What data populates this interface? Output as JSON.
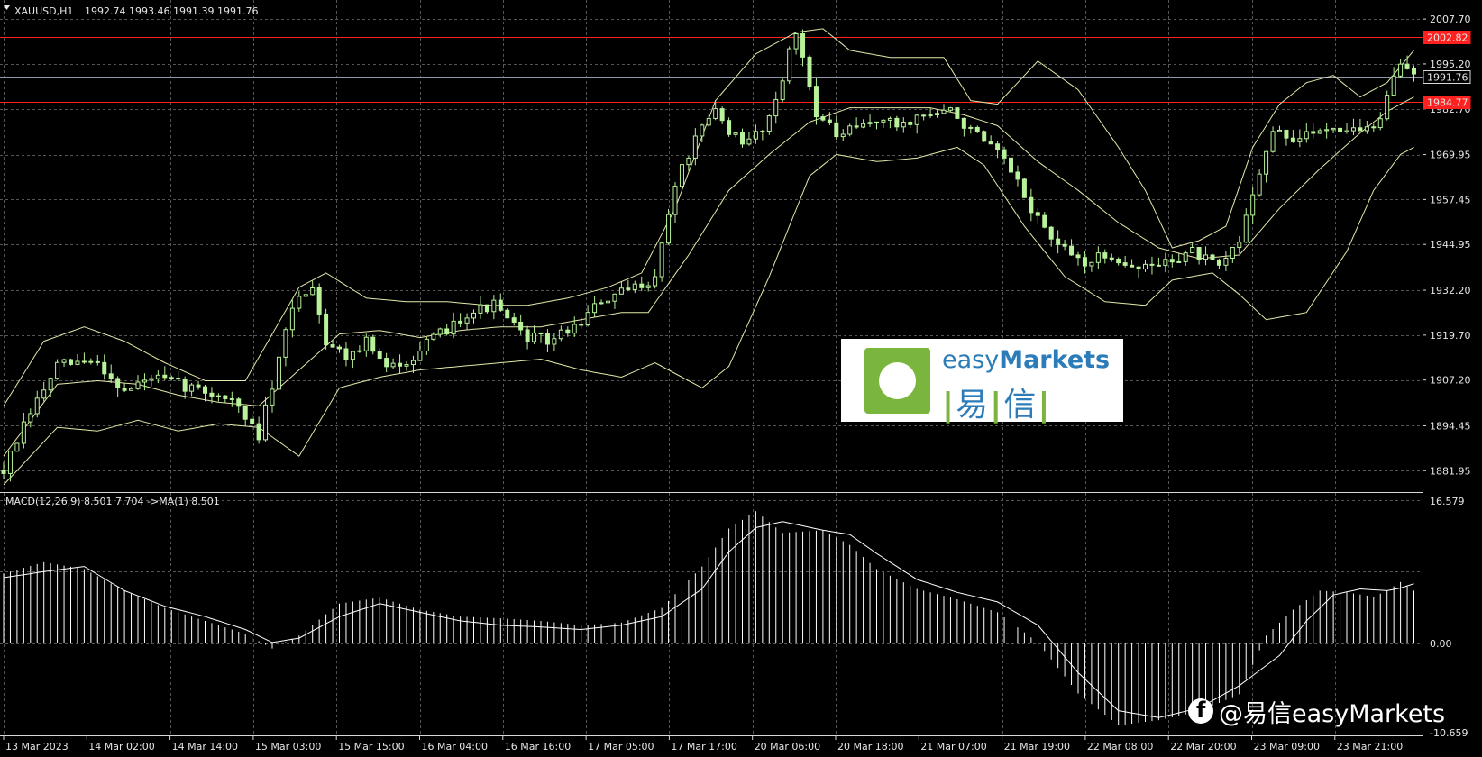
{
  "header": {
    "symbol": "XAUUSD,H1",
    "ohlc": "1992.74 1993.46 1991.39 1991.76",
    "macd_label": "MACD(12,26,9) 8.501 7.704  ->MA(1) 8.501"
  },
  "colors": {
    "background": "#000000",
    "grid": "#555555",
    "candle": "#b8f29a",
    "band": "#e4e8a8",
    "level_red": "#ff2020",
    "bid_line": "#8d99a6",
    "macd": "#ffffff"
  },
  "watermark": {
    "brand_light": "easy",
    "brand_bold": "Markets",
    "cn_1": "易",
    "cn_2": "信",
    "social": "@易信easyMarkets"
  },
  "chart_data": [
    {
      "type": "candlestick",
      "series_name": "XAUUSD,H1",
      "ylim": [
        1876,
        2013
      ],
      "y_ticks": [
        2007.7,
        1995.2,
        1982.7,
        1969.95,
        1957.45,
        1944.95,
        1932.2,
        1919.7,
        1907.2,
        1894.45,
        1881.95
      ],
      "x_ticks": [
        "13 Mar 2023",
        "14 Mar 02:00",
        "14 Mar 14:00",
        "15 Mar 03:00",
        "15 Mar 15:00",
        "16 Mar 04:00",
        "16 Mar 16:00",
        "17 Mar 05:00",
        "17 Mar 17:00",
        "20 Mar 06:00",
        "20 Mar 18:00",
        "21 Mar 07:00",
        "21 Mar 19:00",
        "22 Mar 08:00",
        "22 Mar 20:00",
        "23 Mar 09:00",
        "23 Mar 21:00"
      ],
      "close_path": [
        [
          0,
          1882
        ],
        [
          4,
          1898
        ],
        [
          8,
          1911
        ],
        [
          11,
          1912
        ],
        [
          14,
          1912
        ],
        [
          18,
          1904
        ],
        [
          22,
          1908
        ],
        [
          26,
          1906
        ],
        [
          30,
          1904
        ],
        [
          34,
          1902
        ],
        [
          36,
          1896
        ],
        [
          38,
          1892
        ],
        [
          41,
          1912
        ],
        [
          43,
          1928
        ],
        [
          46,
          1934
        ],
        [
          48,
          1918
        ],
        [
          51,
          1914
        ],
        [
          54,
          1918
        ],
        [
          57,
          1910
        ],
        [
          61,
          1914
        ],
        [
          65,
          1920
        ],
        [
          69,
          1926
        ],
        [
          73,
          1928
        ],
        [
          77,
          1920
        ],
        [
          81,
          1918
        ],
        [
          85,
          1922
        ],
        [
          89,
          1929
        ],
        [
          93,
          1932
        ],
        [
          97,
          1936
        ],
        [
          100,
          1962
        ],
        [
          103,
          1974
        ],
        [
          106,
          1982
        ],
        [
          110,
          1972
        ],
        [
          114,
          1980
        ],
        [
          118,
          2004
        ],
        [
          121,
          1982
        ],
        [
          124,
          1975
        ],
        [
          127,
          1977
        ],
        [
          130,
          1980
        ],
        [
          133,
          1978
        ],
        [
          137,
          1981
        ],
        [
          141,
          1982
        ],
        [
          145,
          1975
        ],
        [
          149,
          1968
        ],
        [
          153,
          1955
        ],
        [
          157,
          1944
        ],
        [
          161,
          1940
        ],
        [
          165,
          1942
        ],
        [
          169,
          1938
        ],
        [
          173,
          1940
        ],
        [
          177,
          1943
        ],
        [
          181,
          1938
        ],
        [
          184,
          1946
        ],
        [
          186,
          1960
        ],
        [
          189,
          1976
        ],
        [
          193,
          1974
        ],
        [
          197,
          1978
        ],
        [
          201,
          1977
        ],
        [
          204,
          1977
        ],
        [
          206,
          1985
        ],
        [
          208,
          1996
        ],
        [
          210,
          1992
        ]
      ],
      "bollinger_upper": [
        [
          0,
          1900
        ],
        [
          6,
          1918
        ],
        [
          12,
          1922
        ],
        [
          18,
          1918
        ],
        [
          24,
          1912
        ],
        [
          30,
          1907
        ],
        [
          36,
          1907
        ],
        [
          40,
          1920
        ],
        [
          44,
          1933
        ],
        [
          48,
          1937
        ],
        [
          54,
          1930
        ],
        [
          60,
          1929
        ],
        [
          66,
          1929
        ],
        [
          72,
          1928
        ],
        [
          78,
          1928
        ],
        [
          84,
          1930
        ],
        [
          90,
          1933
        ],
        [
          95,
          1937
        ],
        [
          100,
          1955
        ],
        [
          106,
          1985
        ],
        [
          112,
          1998
        ],
        [
          118,
          2004
        ],
        [
          122,
          2005
        ],
        [
          126,
          1999
        ],
        [
          132,
          1997
        ],
        [
          140,
          1997
        ],
        [
          144,
          1985
        ],
        [
          148,
          1984
        ],
        [
          154,
          1996
        ],
        [
          160,
          1988
        ],
        [
          166,
          1972
        ],
        [
          170,
          1960
        ],
        [
          174,
          1944
        ],
        [
          178,
          1946
        ],
        [
          182,
          1950
        ],
        [
          186,
          1972
        ],
        [
          190,
          1984
        ],
        [
          194,
          1990
        ],
        [
          198,
          1992
        ],
        [
          202,
          1986
        ],
        [
          206,
          1990
        ],
        [
          210,
          1999
        ]
      ],
      "bollinger_lower": [
        [
          0,
          1878
        ],
        [
          8,
          1894
        ],
        [
          14,
          1893
        ],
        [
          20,
          1896
        ],
        [
          26,
          1893
        ],
        [
          32,
          1895
        ],
        [
          38,
          1894
        ],
        [
          44,
          1886
        ],
        [
          50,
          1905
        ],
        [
          56,
          1908
        ],
        [
          62,
          1910
        ],
        [
          68,
          1911
        ],
        [
          74,
          1912
        ],
        [
          80,
          1913
        ],
        [
          86,
          1910
        ],
        [
          92,
          1908
        ],
        [
          97,
          1912
        ],
        [
          104,
          1905
        ],
        [
          108,
          1911
        ],
        [
          114,
          1936
        ],
        [
          120,
          1964
        ],
        [
          124,
          1970
        ],
        [
          130,
          1968
        ],
        [
          136,
          1969
        ],
        [
          142,
          1972
        ],
        [
          146,
          1967
        ],
        [
          152,
          1950
        ],
        [
          158,
          1936
        ],
        [
          164,
          1929
        ],
        [
          170,
          1928
        ],
        [
          174,
          1935
        ],
        [
          180,
          1937
        ],
        [
          184,
          1931
        ],
        [
          188,
          1924
        ],
        [
          194,
          1926
        ],
        [
          200,
          1943
        ],
        [
          204,
          1960
        ],
        [
          208,
          1970
        ],
        [
          210,
          1972
        ]
      ],
      "bollinger_middle": [
        [
          0,
          1886
        ],
        [
          8,
          1906
        ],
        [
          14,
          1907
        ],
        [
          20,
          1906
        ],
        [
          26,
          1903
        ],
        [
          32,
          1901
        ],
        [
          38,
          1900
        ],
        [
          44,
          1910
        ],
        [
          50,
          1920
        ],
        [
          56,
          1921
        ],
        [
          62,
          1919
        ],
        [
          68,
          1921
        ],
        [
          74,
          1922
        ],
        [
          80,
          1922
        ],
        [
          86,
          1924
        ],
        [
          92,
          1926
        ],
        [
          96,
          1926
        ],
        [
          102,
          1942
        ],
        [
          108,
          1960
        ],
        [
          114,
          1970
        ],
        [
          120,
          1979
        ],
        [
          126,
          1983
        ],
        [
          132,
          1983
        ],
        [
          138,
          1983
        ],
        [
          143,
          1981
        ],
        [
          148,
          1978
        ],
        [
          154,
          1968
        ],
        [
          160,
          1960
        ],
        [
          166,
          1951
        ],
        [
          172,
          1944
        ],
        [
          178,
          1941
        ],
        [
          184,
          1942
        ],
        [
          190,
          1955
        ],
        [
          196,
          1966
        ],
        [
          202,
          1976
        ],
        [
          206,
          1982
        ],
        [
          210,
          1986
        ]
      ],
      "levels": [
        {
          "label": "2002.82",
          "value": 2002.82,
          "color": "#ff2020"
        },
        {
          "label": "1984.77",
          "value": 1984.77,
          "color": "#ff2020"
        },
        {
          "label": "1991.76",
          "value": 1991.76,
          "color": "#8d99a6"
        }
      ]
    },
    {
      "type": "histogram",
      "series_name": "MACD(12,26,9)",
      "ylim": [
        -10.659,
        16.579
      ],
      "y_ticks": [
        16.579,
        0.0,
        -10.659
      ],
      "macd": [
        [
          0,
          8.1
        ],
        [
          6,
          9.4
        ],
        [
          12,
          8.6
        ],
        [
          18,
          6.1
        ],
        [
          24,
          4.1
        ],
        [
          30,
          2.6
        ],
        [
          36,
          1.1
        ],
        [
          40,
          -0.6
        ],
        [
          44,
          0.9
        ],
        [
          50,
          4.6
        ],
        [
          56,
          5.3
        ],
        [
          62,
          3.9
        ],
        [
          68,
          3.1
        ],
        [
          74,
          2.9
        ],
        [
          80,
          2.6
        ],
        [
          86,
          2.1
        ],
        [
          92,
          2.4
        ],
        [
          98,
          4.1
        ],
        [
          104,
          8.9
        ],
        [
          108,
          13.3
        ],
        [
          112,
          15.3
        ],
        [
          116,
          12.8
        ],
        [
          122,
          13.1
        ],
        [
          126,
          11.4
        ],
        [
          130,
          8.6
        ],
        [
          136,
          6.3
        ],
        [
          142,
          5.1
        ],
        [
          148,
          3.6
        ],
        [
          154,
          0.1
        ],
        [
          160,
          -5.8
        ],
        [
          166,
          -9.5
        ],
        [
          172,
          -8.9
        ],
        [
          178,
          -7.9
        ],
        [
          184,
          -5.9
        ],
        [
          188,
          0.9
        ],
        [
          192,
          3.9
        ],
        [
          196,
          6.1
        ],
        [
          200,
          5.9
        ],
        [
          204,
          5.4
        ],
        [
          206,
          6.1
        ],
        [
          208,
          7.1
        ],
        [
          210,
          6.1
        ]
      ],
      "signal": [
        [
          0,
          7.6
        ],
        [
          6,
          8.3
        ],
        [
          12,
          8.9
        ],
        [
          18,
          6.1
        ],
        [
          24,
          4.3
        ],
        [
          30,
          3.1
        ],
        [
          36,
          1.6
        ],
        [
          40,
          0.1
        ],
        [
          44,
          0.6
        ],
        [
          50,
          3.1
        ],
        [
          56,
          4.6
        ],
        [
          62,
          3.6
        ],
        [
          68,
          2.6
        ],
        [
          74,
          2.1
        ],
        [
          80,
          1.9
        ],
        [
          86,
          1.6
        ],
        [
          92,
          2.1
        ],
        [
          98,
          3.1
        ],
        [
          104,
          6.3
        ],
        [
          108,
          10.6
        ],
        [
          112,
          13.4
        ],
        [
          116,
          14.1
        ],
        [
          122,
          13.1
        ],
        [
          126,
          12.6
        ],
        [
          130,
          10.4
        ],
        [
          136,
          7.4
        ],
        [
          142,
          5.9
        ],
        [
          148,
          4.8
        ],
        [
          154,
          2.1
        ],
        [
          160,
          -3.4
        ],
        [
          166,
          -7.8
        ],
        [
          172,
          -8.6
        ],
        [
          178,
          -7.5
        ],
        [
          184,
          -4.9
        ],
        [
          190,
          -1.4
        ],
        [
          194,
          2.6
        ],
        [
          198,
          5.6
        ],
        [
          202,
          6.3
        ],
        [
          206,
          6.1
        ],
        [
          208,
          6.4
        ],
        [
          210,
          6.9
        ]
      ]
    }
  ]
}
